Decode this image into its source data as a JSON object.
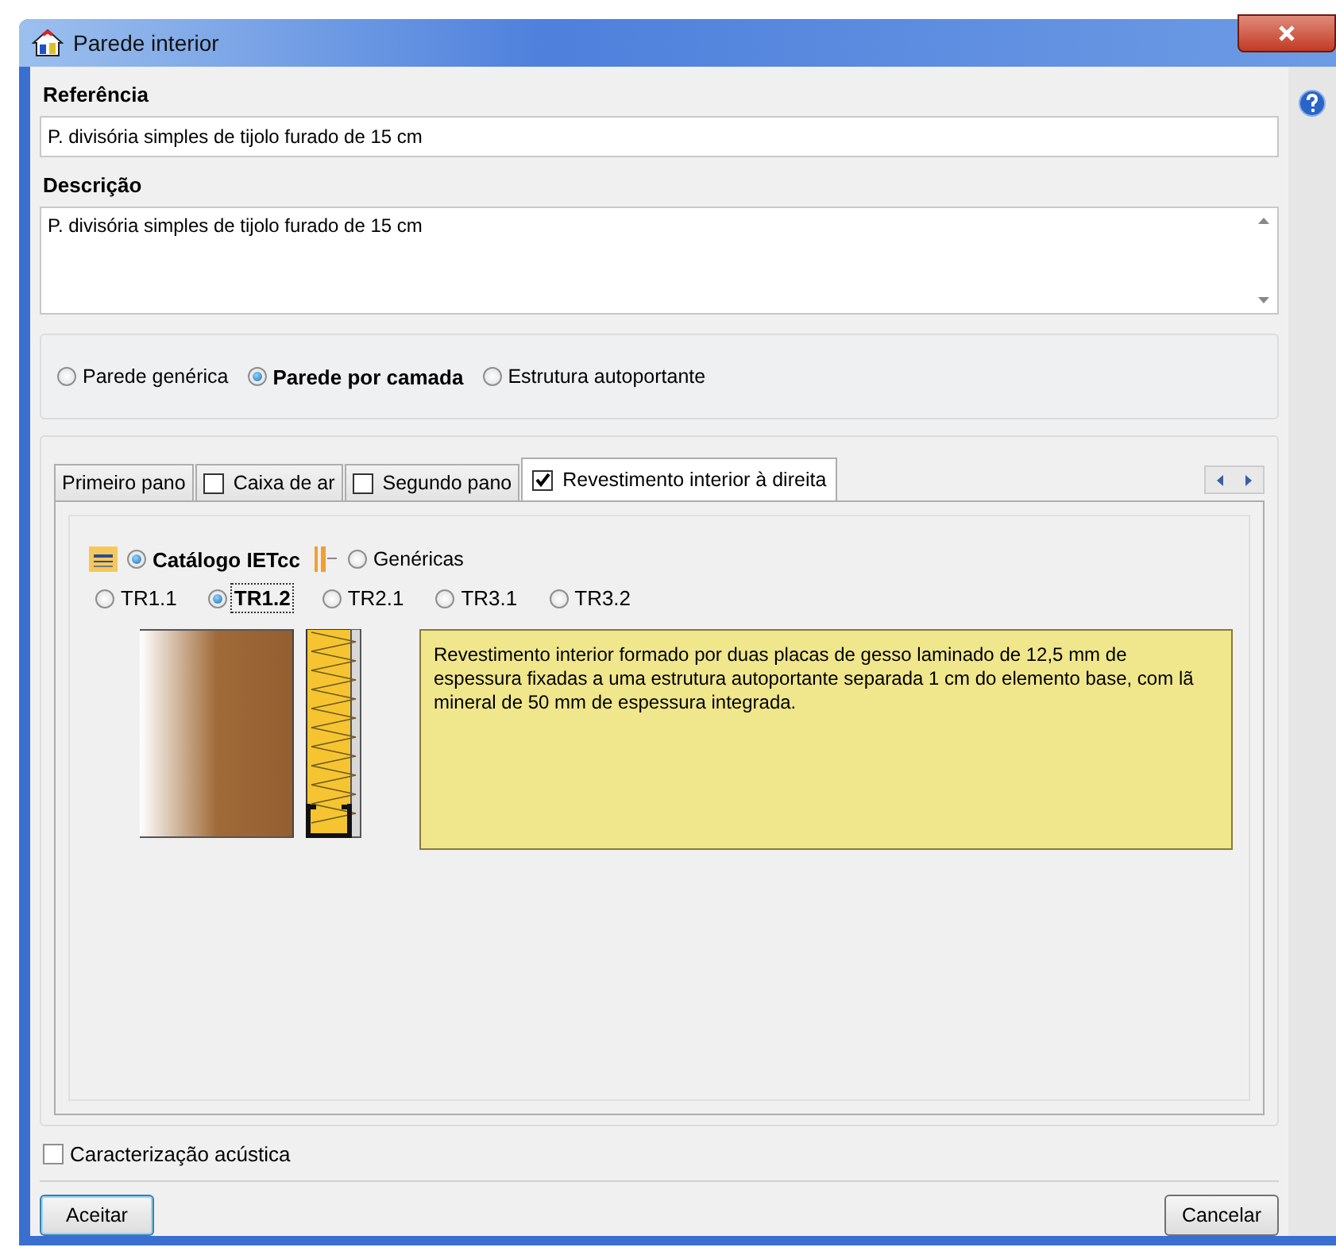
{
  "window": {
    "title": "Parede interior"
  },
  "reference": {
    "label": "Referência",
    "value": "P. divisória simples de tijolo furado de 15 cm"
  },
  "description": {
    "label": "Descrição",
    "value": "P. divisória simples de tijolo furado de 15 cm"
  },
  "wall_types": [
    {
      "label": "Parede genérica",
      "selected": false
    },
    {
      "label": "Parede por camada",
      "selected": true
    },
    {
      "label": "Estrutura autoportante",
      "selected": false
    }
  ],
  "tabs": [
    {
      "label": "Primeiro pano",
      "kind": "plain",
      "selected": false
    },
    {
      "label": "Caixa de ar",
      "kind": "checkbox",
      "checked": false,
      "selected": false
    },
    {
      "label": "Segundo pano",
      "kind": "checkbox",
      "checked": false,
      "selected": false
    },
    {
      "label": "Revestimento interior à direita",
      "kind": "checkbox",
      "checked": true,
      "selected": true
    }
  ],
  "sources": [
    {
      "label": "Catálogo IETcc",
      "kind": "catalog",
      "selected": true
    },
    {
      "label": "Genéricas",
      "kind": "generic",
      "selected": false
    }
  ],
  "types": [
    {
      "label": "TR1.1",
      "selected": false
    },
    {
      "label": "TR1.2",
      "selected": true
    },
    {
      "label": "TR2.1",
      "selected": false
    },
    {
      "label": "TR3.1",
      "selected": false
    },
    {
      "label": "TR3.2",
      "selected": false
    }
  ],
  "info_text": "Revestimento interior formado por duas placas de gesso laminado de 12,5 mm de espessura fixadas a uma estrutura autoportante separada 1 cm do elemento base, com lã mineral de 50 mm de espessura integrada.",
  "acoustic": {
    "label": "Caracterização acústica",
    "checked": false
  },
  "buttons": [
    {
      "label": "Aceitar",
      "kind": "default"
    },
    {
      "label": "Cancelar",
      "kind": "normal"
    }
  ]
}
